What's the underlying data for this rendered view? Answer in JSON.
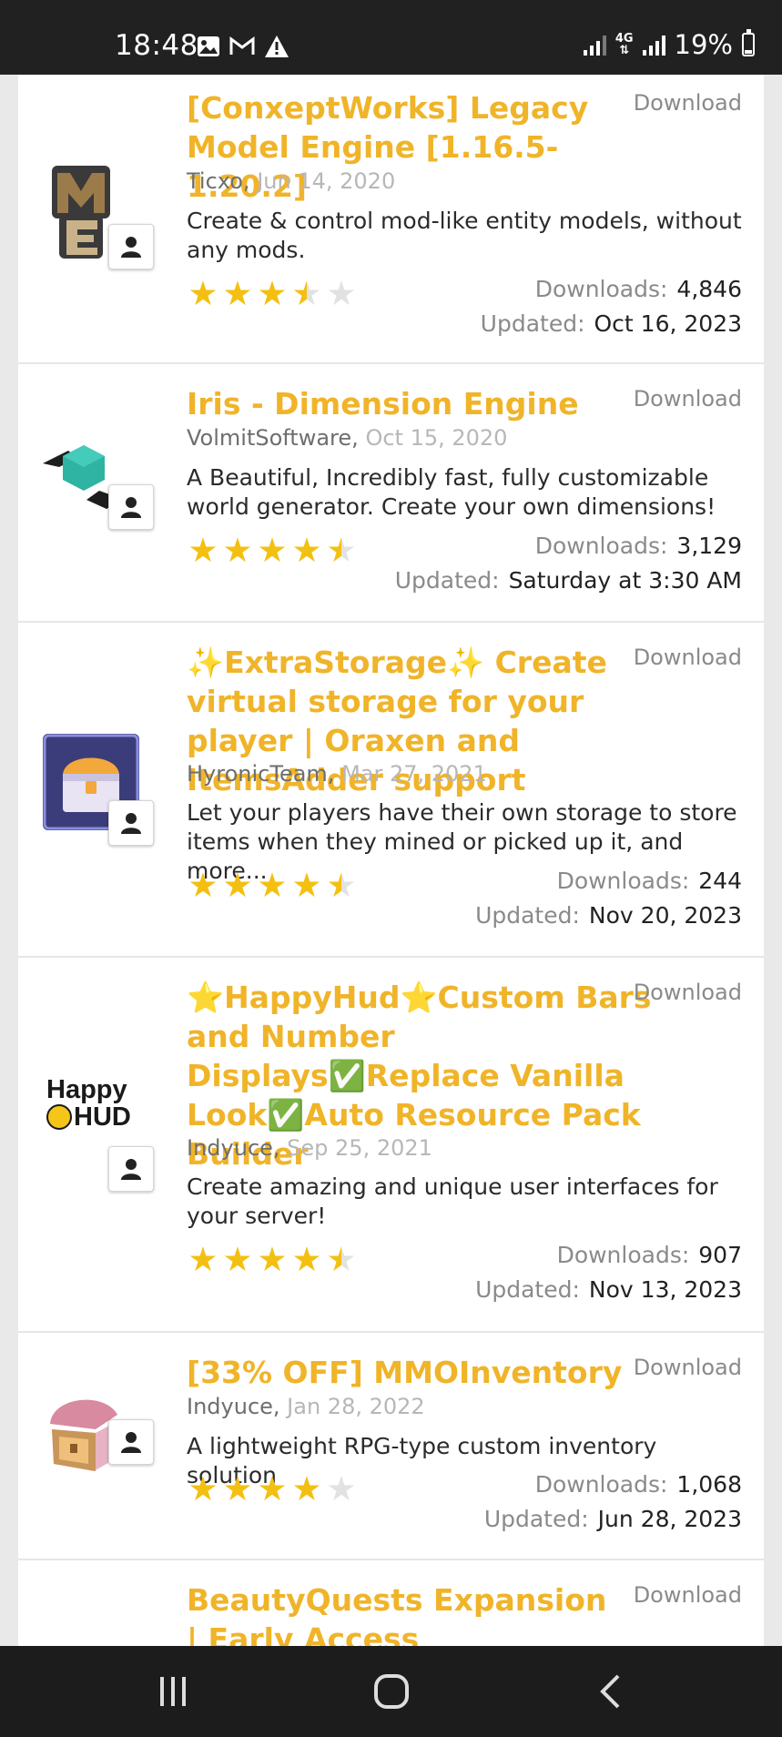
{
  "status_bar": {
    "time": "18:48",
    "network": "4G",
    "battery": "19%"
  },
  "download_label": "Download",
  "downloads_label": "Downloads:",
  "updated_label": "Updated:",
  "resources": [
    {
      "title": "[ConxeptWorks] Legacy Model Engine [1.16.5-1.20.2]",
      "author": "Ticxo,",
      "date": "Jun 14, 2020",
      "description": "Create & control mod-like entity models, without any mods.",
      "rating": 3.5,
      "downloads": "4,846",
      "updated": "Oct 16, 2023",
      "icon": "model-engine-logo-icon"
    },
    {
      "title": "Iris - Dimension Engine",
      "author": "VolmitSoftware,",
      "date": "Oct 15, 2020",
      "description": "A Beautiful, Incredibly fast, fully customizable world generator. Create your own dimensions!",
      "rating": 4.5,
      "downloads": "3,129",
      "updated": "Saturday at 3:30 AM",
      "icon": "iris-hexagon-logo-icon"
    },
    {
      "title": "✨ExtraStorage✨ Create virtual storage for your player | Oraxen and ItemsAdder support",
      "author": "HyronicTeam,",
      "date": "Mar 27, 2021",
      "description": "Let your players have their own storage to store items when they mined or picked up it, and more...",
      "rating": 4.5,
      "downloads": "244",
      "updated": "Nov 20, 2023",
      "icon": "storage-chest-logo-icon"
    },
    {
      "title": "⭐HappyHud⭐Custom Bars and Number Displays✅Replace Vanilla Look✅Auto Resource Pack Builder",
      "author": "Indyuce,",
      "date": "Sep 25, 2021",
      "description": "Create amazing and unique user interfaces for your server!",
      "rating": 4.5,
      "downloads": "907",
      "updated": "Nov 13, 2023",
      "icon": "happyhud-logo-icon",
      "logo_text_1": "Happy",
      "logo_text_2": "HUD"
    },
    {
      "title": "[33% OFF] MMOInventory",
      "author": "Indyuce,",
      "date": "Jan 28, 2022",
      "description": "A lightweight RPG-type custom inventory solution",
      "rating": 4,
      "downloads": "1,068",
      "updated": "Jun 28, 2023",
      "icon": "treasure-chest-logo-icon"
    },
    {
      "title": "BeautyQuests Expansion | Early Access"
    }
  ],
  "colors": {
    "title": "#f0b429",
    "star": "#f3c012",
    "status_bar": "#212121",
    "nav_bar": "#1c1c1c"
  }
}
